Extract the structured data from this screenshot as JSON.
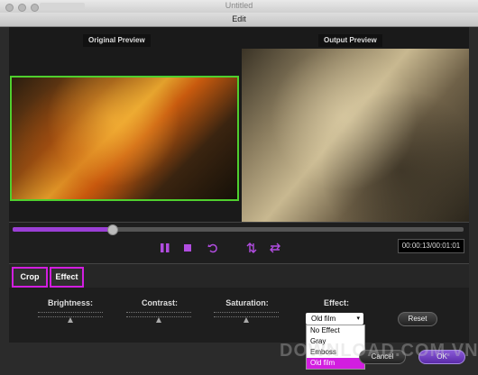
{
  "window": {
    "app_title": "Untitled",
    "dialog_title": "Edit"
  },
  "preview": {
    "original_label": "Original Preview",
    "output_label": "Output Preview"
  },
  "playback": {
    "progress_fraction": 0.22,
    "time_display": "00:00:13/00:01:01"
  },
  "tabs": {
    "crop_label": "Crop",
    "effect_label": "Effect"
  },
  "adjustments": {
    "brightness_label": "Brightness:",
    "contrast_label": "Contrast:",
    "saturation_label": "Saturation:",
    "brightness_value": 0.5,
    "contrast_value": 0.5,
    "saturation_value": 0.5
  },
  "effect": {
    "label": "Effect:",
    "selected": "Old film",
    "options": [
      "No Effect",
      "Gray",
      "Emboss",
      "Old film"
    ]
  },
  "buttons": {
    "reset": "Reset",
    "cancel": "Cancel",
    "ok": "OK"
  },
  "watermark": "DOWNLOAD.COM.VN",
  "colors": {
    "accent": "#d21ee0",
    "selection_border": "#4fcf2e"
  }
}
